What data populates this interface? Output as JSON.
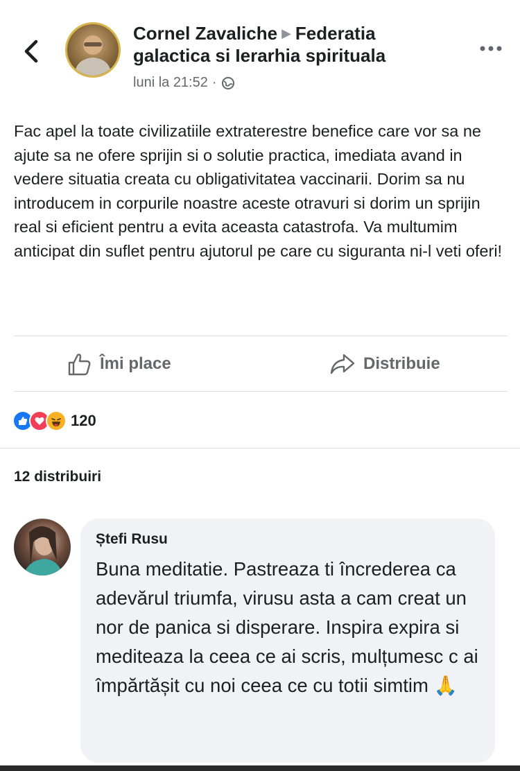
{
  "post": {
    "author": "Cornel Zavaliche",
    "group_line1": "Federatia",
    "group_line2": "galactica si Ierarhia spirituala",
    "timestamp": "luni la 21:52",
    "separator": "·",
    "privacy_icon": "globe-icon",
    "text": "Fac apel la toate civilizatiile extraterestre benefice care vor sa ne ajute  sa ne ofere sprijin si o solutie practica, imediata avand in vedere situatia creata cu obligativitatea vaccinarii. Dorim sa nu introducem in corpurile noastre aceste otravuri si dorim un sprijin real si eficient pentru a evita aceasta catastrofa. Va multumim anticipat din suflet pentru ajutorul pe care cu siguranta ni-l veti oferi!"
  },
  "actions": {
    "like_label": "Îmi place",
    "share_label": "Distribuie"
  },
  "reactions": {
    "icons": [
      "like-reaction-icon",
      "love-reaction-icon",
      "haha-reaction-icon"
    ],
    "count": "120"
  },
  "shares": {
    "label": "12 distribuiri"
  },
  "comment": {
    "author": "Ștefi Rusu",
    "text": "Buna meditatie. Pastreaza ti încrederea ca adevărul triumfa, virusu asta a cam creat un nor de panica si disperare. Inspira expira si mediteaza la ceea ce ai scris, mulțumesc c ai împărtășit cu noi ceea ce cu totii simtim",
    "emoji": "🙏"
  },
  "colors": {
    "text": "#1c1e21",
    "secondary": "#65676b",
    "divider": "#dadde1",
    "bubble": "#f0f2f5",
    "like_blue": "#1877f2",
    "love_red": "#f33e58",
    "haha_yellow": "#f7b125"
  }
}
